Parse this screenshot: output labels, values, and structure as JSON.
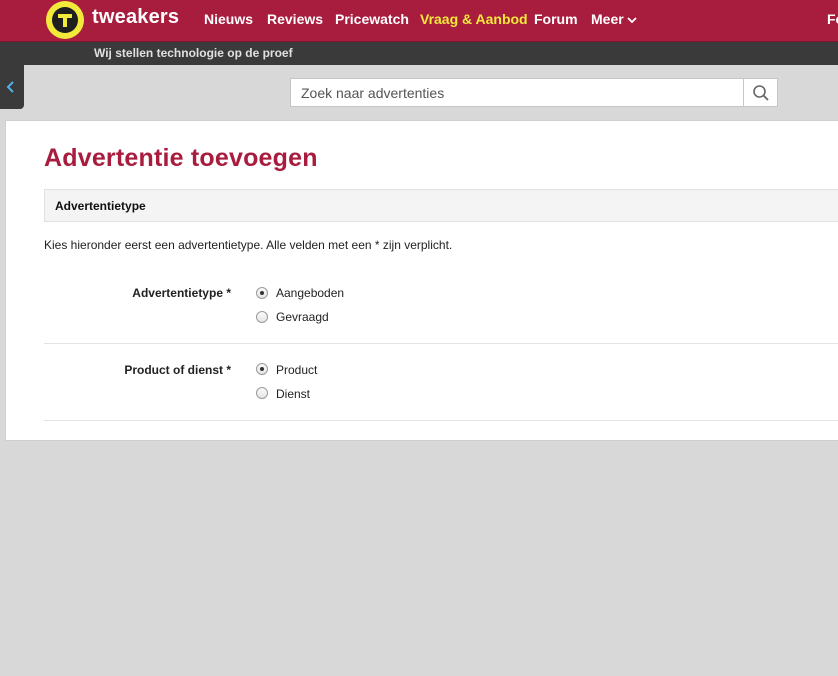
{
  "header": {
    "logo_text": "tweakers",
    "nav": [
      {
        "label": "Nieuws",
        "active": false
      },
      {
        "label": "Reviews",
        "active": false
      },
      {
        "label": "Pricewatch",
        "active": false
      },
      {
        "label": "Vraag & Aanbod",
        "active": true
      },
      {
        "label": "Forum",
        "active": false
      },
      {
        "label": "Meer",
        "active": false
      },
      {
        "label": "Fo",
        "active": false
      }
    ],
    "tagline": "Wij stellen technologie op de proef",
    "colors": {
      "brand": "#a81c3e",
      "active_nav": "#f2ea3a",
      "logo_yellow": "#f2ea3a"
    }
  },
  "search": {
    "placeholder": "Zoek naar advertenties",
    "icon": "search-icon"
  },
  "sidebar_toggle": {
    "icon": "chevron-left-icon"
  },
  "main": {
    "title": "Advertentie toevoegen",
    "section_header": "Advertentietype",
    "intro": "Kies hieronder eerst een advertentietype. Alle velden met een * zijn verplicht.",
    "fields": [
      {
        "label": "Advertentietype *",
        "options": [
          {
            "label": "Aangeboden",
            "checked": true
          },
          {
            "label": "Gevraagd",
            "checked": false
          }
        ]
      },
      {
        "label": "Product of dienst *",
        "options": [
          {
            "label": "Product",
            "checked": true
          },
          {
            "label": "Dienst",
            "checked": false
          }
        ]
      }
    ]
  }
}
